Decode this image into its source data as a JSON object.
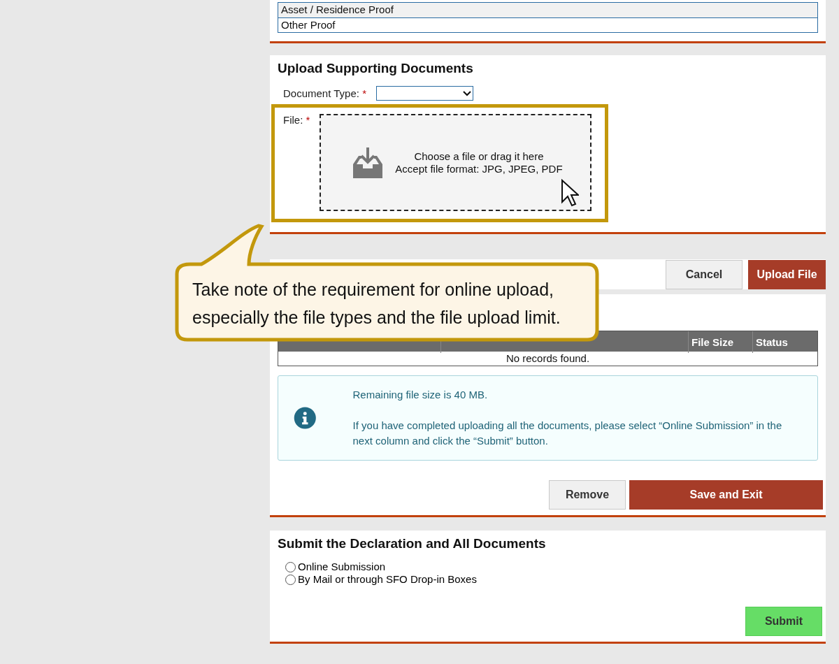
{
  "proof_table": {
    "rows": [
      {
        "label": "Asset / Residence Proof"
      },
      {
        "label": "Other Proof"
      }
    ]
  },
  "upload_section": {
    "title": "Upload Supporting Documents",
    "document_type": {
      "label": "Document Type:",
      "required_mark": "*"
    },
    "file": {
      "label": "File:",
      "required_mark": "*",
      "drop_text": "Choose a file or drag it here",
      "formats_text": "Accept file format: JPG, JPEG, PDF"
    }
  },
  "toolbar": {
    "buttons": [
      {
        "label": "Cancel",
        "kind": "secondary"
      },
      {
        "label": "Upload File",
        "kind": "primary"
      }
    ]
  },
  "records_table": {
    "columns": [
      {
        "covered": true
      },
      {
        "covered": true
      },
      {
        "label": "File Size",
        "covered": false
      },
      {
        "label": "Status",
        "covered": false
      }
    ],
    "empty_text": "No records found."
  },
  "info": {
    "paragraphs": [
      "Remaining file size is 40 MB.",
      "If you have completed uploading all the documents, please select “Online Submission” in the next column and click the “Submit” button."
    ]
  },
  "actions": {
    "buttons": [
      {
        "label": "Remove",
        "kind": "secondary"
      },
      {
        "label": "Save and Exit",
        "kind": "primary"
      }
    ]
  },
  "submit_section": {
    "title": "Submit the Declaration and All Documents",
    "options": [
      {
        "label": "Online Submission",
        "selected": false
      },
      {
        "label": "By Mail or through SFO Drop-in Boxes",
        "selected": false
      }
    ],
    "button": "Submit"
  },
  "callout": {
    "text": "Take note of the requirement for online upload,\nespecially the file types and the file upload limit."
  }
}
